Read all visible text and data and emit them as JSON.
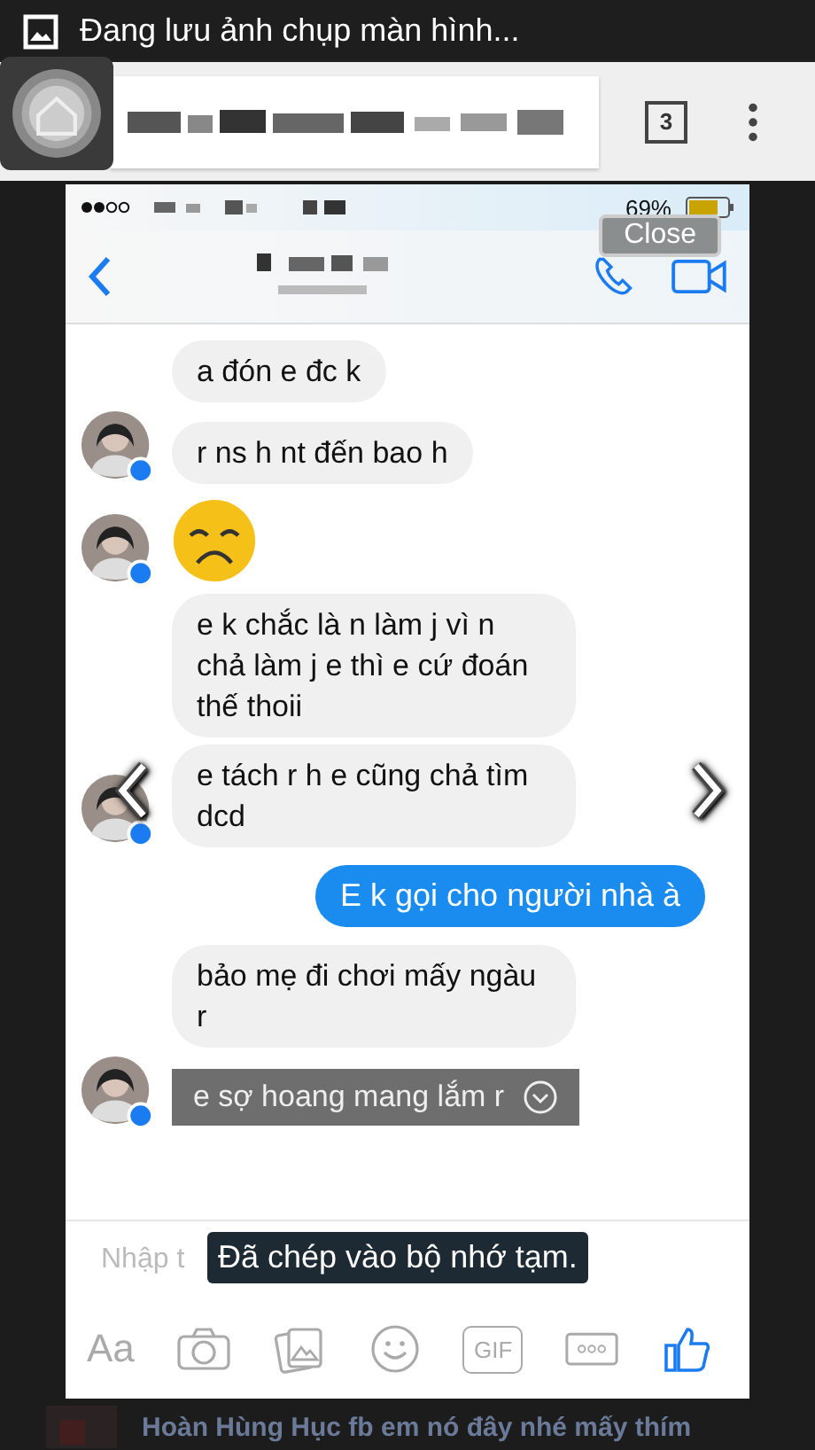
{
  "notification": {
    "text": "Đang lưu ảnh chụp màn hình..."
  },
  "browser": {
    "tab_count": "3"
  },
  "ios_status": {
    "battery": "69%"
  },
  "close_button": "Close",
  "messages": [
    {
      "kind": "text",
      "outgoing": false,
      "avatar": false,
      "text": "a đón e đc k"
    },
    {
      "kind": "text",
      "outgoing": false,
      "avatar": true,
      "text": "r ns h nt đến bao h"
    },
    {
      "kind": "emoji",
      "outgoing": false,
      "avatar": true
    },
    {
      "kind": "text",
      "outgoing": false,
      "avatar": false,
      "text": "e k chắc là n làm j vì n chả làm j e thì e cứ đoán thế thoii"
    },
    {
      "kind": "text",
      "outgoing": false,
      "avatar": true,
      "text": "e tách r h e cũng chả tìm dcd"
    },
    {
      "kind": "text",
      "outgoing": true,
      "text": "E k gọi cho người nhà à"
    },
    {
      "kind": "text",
      "outgoing": false,
      "avatar": false,
      "text": "bảo mẹ đi chơi mấy ngàu r"
    },
    {
      "kind": "selected",
      "outgoing": false,
      "avatar": true,
      "text": "e sợ hoang mang lắm r"
    }
  ],
  "composer": {
    "placeholder": "Nhập t"
  },
  "toolbar": {
    "text_button": "Aa",
    "gif_button": "GIF"
  },
  "toast": "Đã chép vào bộ nhớ tạm.",
  "background_post": {
    "text": "Hoàn Hùng Hục fb em nó đây nhé mấy thím"
  }
}
